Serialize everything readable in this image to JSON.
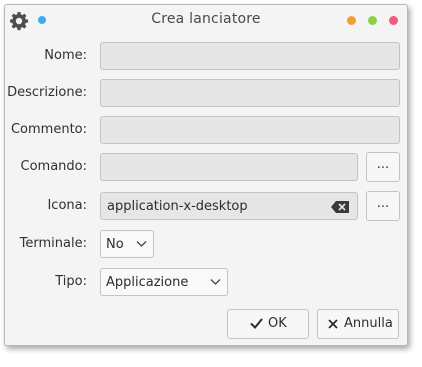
{
  "window": {
    "title": "Crea lanciatore"
  },
  "titlebar": {
    "menu_icon": "gear-icon",
    "pin_color": "#3daee9",
    "minimize_color": "#f39c3b",
    "maximize_color": "#8ccf45",
    "close_color": "#ef5a7e"
  },
  "form": {
    "name_label": "Nome:",
    "name_value": "",
    "description_label": "Descrizione:",
    "description_value": "",
    "comment_label": "Commento:",
    "comment_value": "",
    "command_label": "Comando:",
    "command_value": "",
    "command_browse_label": "...",
    "icon_label": "Icona:",
    "icon_value": "application-x-desktop",
    "icon_clear_icon": "backspace-icon",
    "icon_browse_label": "...",
    "terminal_label": "Terminale:",
    "terminal_value": "No",
    "type_label": "Tipo:",
    "type_value": "Applicazione"
  },
  "buttons": {
    "ok_label": "OK",
    "ok_icon": "checkmark-icon",
    "cancel_label": "Annulla",
    "cancel_icon": "x-icon"
  }
}
